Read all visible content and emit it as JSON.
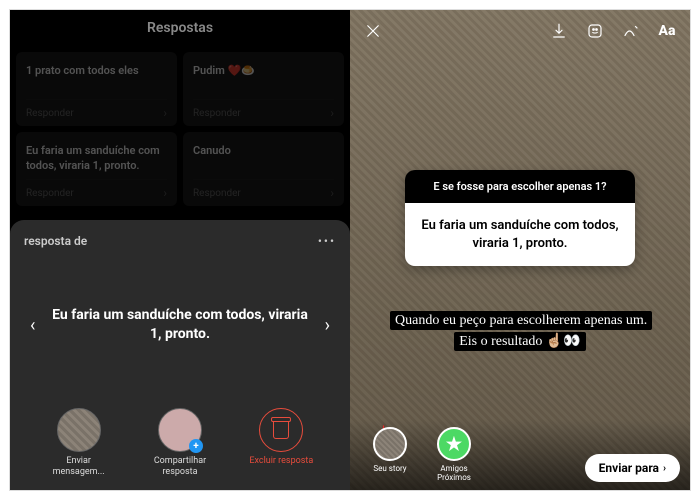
{
  "left": {
    "header": "Respostas",
    "cards": [
      {
        "text": "1 prato com todos eles",
        "foot": "Responder"
      },
      {
        "text": "Pudim ❤️🍮",
        "foot": "Responder"
      },
      {
        "text": "Eu faria um sanduíche com todos, viraria 1, pronto.",
        "foot": "Responder"
      },
      {
        "text": "Canudo",
        "foot": "Responder"
      }
    ],
    "sheet": {
      "title": "resposta de",
      "body": "Eu faria um sanduíche com todos, viraria 1, pronto.",
      "actions": {
        "send": "Enviar mensagem...",
        "share": "Compartilhar resposta",
        "delete": "Excluir resposta"
      }
    }
  },
  "right": {
    "question": {
      "head": "E se fosse para escolher apenas 1?",
      "body": "Eu faria um sanduíche com todos, viraria 1, pronto."
    },
    "caption": "Quando eu peço para escolherem apenas um. Eis o resultado ☝🏼👀",
    "toolbar": {
      "text_tool": "Aa"
    },
    "bottom": {
      "your_story": "Seu story",
      "close_friends": "Amigos Próximos",
      "send": "Enviar para",
      "star": "★"
    }
  }
}
